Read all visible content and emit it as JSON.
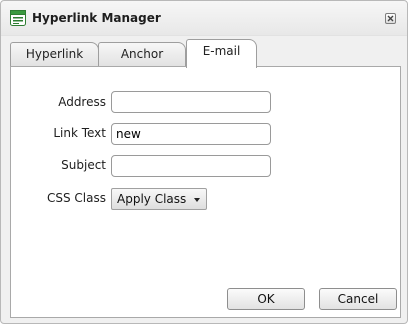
{
  "window": {
    "title": "Hyperlink Manager",
    "icon": "hyperlink-manager-icon",
    "close_icon": "close-icon"
  },
  "tabs": [
    {
      "label": "Hyperlink",
      "active": false
    },
    {
      "label": "Anchor",
      "active": false
    },
    {
      "label": "E-mail",
      "active": true
    }
  ],
  "form": {
    "address": {
      "label": "Address",
      "value": ""
    },
    "link_text": {
      "label": "Link Text",
      "value": "new"
    },
    "subject": {
      "label": "Subject",
      "value": ""
    },
    "css_class": {
      "label": "CSS Class",
      "selected": "Apply Class"
    }
  },
  "buttons": {
    "ok": "OK",
    "cancel": "Cancel"
  }
}
